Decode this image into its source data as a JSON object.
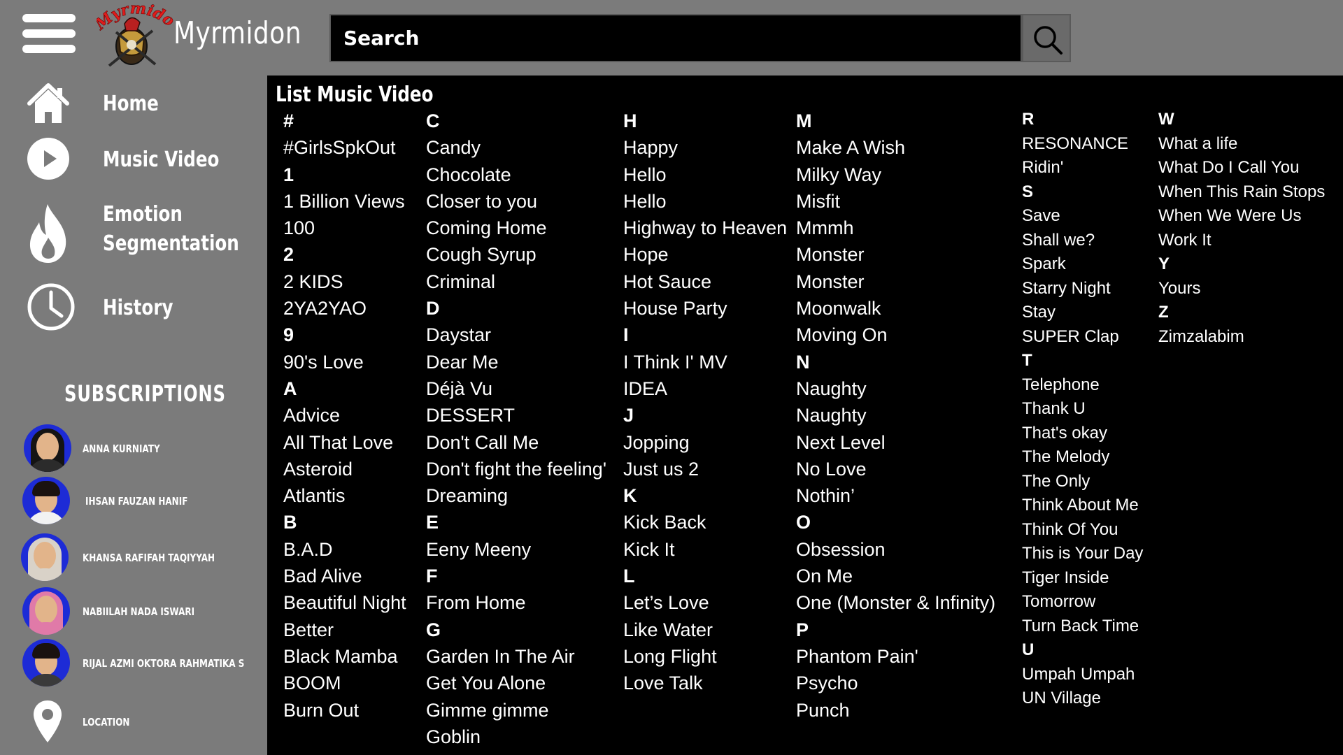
{
  "header": {
    "menu_icon": "hamburger-menu-icon",
    "logo_text": "Myrmidon",
    "brand_name": "Myrmidon",
    "search_placeholder": "Search",
    "search_icon": "search-icon"
  },
  "sidebar": {
    "nav": [
      {
        "label": "Home",
        "icon": "home-icon"
      },
      {
        "label": "Music Video",
        "icon": "play-icon"
      },
      {
        "label": "Emotion Segmentation",
        "icon": "flame-icon"
      },
      {
        "label": "History",
        "icon": "clock-icon"
      }
    ],
    "subscriptions_title": "SUBSCRIPTIONS",
    "subscriptions": [
      {
        "name": "ANNA KURNIATY"
      },
      {
        "name": "IHSAN FAUZAN HANIF"
      },
      {
        "name": "KHANSA RAFIFAH TAQIYYAH"
      },
      {
        "name": "NABIILAH NADA ISWARI"
      },
      {
        "name": "RIJAL AZMI OKTORA RAHMATIKA S"
      }
    ],
    "location_label": "LOCATION",
    "location_icon": "location-pin-icon"
  },
  "main": {
    "title": "List Music Video",
    "columns": [
      [
        "#",
        "#GirlsSpkOut",
        "1",
        "1 Billion Views",
        "100",
        "2",
        "2 KIDS",
        "2YA2YAO",
        "9",
        "90's Love",
        "A",
        "Advice",
        "All That Love",
        "Asteroid",
        "Atlantis",
        "B",
        "B.A.D",
        "Bad Alive",
        "Beautiful Night",
        "Better",
        "Black Mamba",
        "BOOM",
        "Burn Out"
      ],
      [
        "C",
        "Candy",
        "Chocolate",
        "Closer to you",
        "Coming Home",
        "Cough Syrup",
        "Criminal",
        "D",
        "Daystar",
        "Dear Me",
        "Déjà Vu",
        "DESSERT",
        "Don't Call Me",
        "Don't fight the feeling'",
        "Dreaming",
        "E",
        "Eeny Meeny",
        "F",
        "From Home",
        "G",
        "Garden In The Air",
        "Get You Alone",
        "Gimme gimme",
        "Goblin"
      ],
      [
        "H",
        "Happy",
        "Hello",
        "Hello",
        "Highway to Heaven",
        "Hope",
        "Hot Sauce",
        "House Party",
        "I",
        "I Think I' MV",
        "IDEA",
        "J",
        "Jopping",
        "Just us 2",
        "K",
        "Kick Back",
        "Kick It",
        "L",
        "Let’s Love",
        "Like Water",
        "Long Flight",
        "Love Talk"
      ],
      [
        "M",
        "Make A Wish",
        "Milky Way",
        "Misfit",
        "Mmmh",
        "Monster",
        "Monster",
        "Moonwalk",
        "Moving On",
        "N",
        "Naughty",
        "Naughty",
        "Next Level",
        "No Love",
        "Nothin’",
        "O",
        "Obsession",
        "On Me",
        "One (Monster & Infinity)",
        "P",
        "Phantom Pain'",
        "Psycho",
        "Punch"
      ],
      [
        "R",
        "RESONANCE",
        "Ridin'",
        "S",
        "Save",
        "Shall we?",
        "Spark",
        "Starry Night",
        "Stay",
        "SUPER Clap",
        "T",
        "Telephone",
        "Thank U",
        "That's okay",
        "The Melody",
        "The Only",
        "Think About Me",
        "Think Of You",
        "This is Your Day",
        "Tiger Inside",
        "Tomorrow",
        "Turn Back Time",
        "U",
        "Umpah Umpah",
        "UN Village"
      ],
      [
        "W",
        "What a life",
        "What Do I Call You",
        "When This Rain Stops",
        "When We Were Us",
        "Work It",
        "Y",
        "Yours",
        "Z",
        "Zimzalabim"
      ]
    ]
  }
}
